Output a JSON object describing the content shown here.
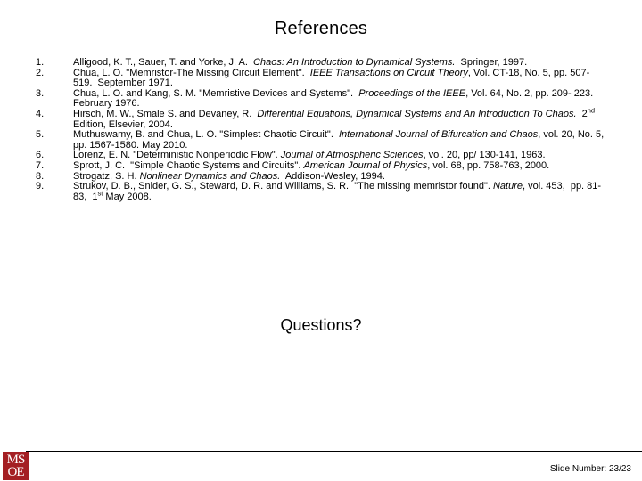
{
  "slide": {
    "title": "References",
    "questions": "Questions?",
    "slide_number_label": "Slide Number: 23/23"
  },
  "logo": {
    "name": "msoe-logo",
    "line1": "MS",
    "line2": "OE",
    "color": "#A41F23"
  },
  "references": [
    {
      "number": "1.",
      "text_html": "Alligood, K. T., Sauer, T. and Yorke, J. A.&nbsp; <i>Chaos: An Introduction to Dynamical Systems.</i>&nbsp; Springer, 1997.",
      "plain": "Alligood, K. T., Sauer, T. and Yorke, J. A. Chaos: An Introduction to Dynamical Systems. Springer, 1997."
    },
    {
      "number": "2.",
      "text_html": "Chua, L. O. \"Memristor-The Missing Circuit Element\".&nbsp; <i>IEEE Transactions on Circuit Theory</i>, Vol. CT-18, No. 5, pp. 507- 519.&nbsp; September 1971.",
      "plain": "Chua, L. O. \"Memristor-The Missing Circuit Element\". IEEE Transactions on Circuit Theory, Vol. CT-18, No. 5, pp. 507- 519. September 1971."
    },
    {
      "number": "3.",
      "text_html": "Chua, L. O. and Kang, S. M. \"Memristive Devices and Systems\".&nbsp; <i>Proceedings of the IEEE</i>, Vol. 64, No. 2, pp. 209- 223.&nbsp; February 1976.",
      "plain": "Chua, L. O. and Kang, S. M. \"Memristive Devices and Systems\". Proceedings of the IEEE, Vol. 64, No. 2, pp. 209- 223. February 1976."
    },
    {
      "number": "4.",
      "text_html": "Hirsch, M. W., Smale S. and Devaney, R.&nbsp; <i>Differential Equations, Dynamical Systems and An Introduction To Chaos.</i>&nbsp; 2<sup>nd</sup> Edition, Elsevier, 2004.",
      "plain": "Hirsch, M. W., Smale S. and Devaney, R. Differential Equations, Dynamical Systems and An Introduction To Chaos. 2nd Edition, Elsevier, 2004."
    },
    {
      "number": "5.",
      "text_html": "Muthuswamy, B. and Chua, L. O. \"Simplest Chaotic Circuit\".&nbsp; <i>International Journal of Bifurcation and Chaos</i>, vol. 20, No. 5, pp. 1567-1580. May 2010.",
      "plain": "Muthuswamy, B. and Chua, L. O. \"Simplest Chaotic Circuit\". International Journal of Bifurcation and Chaos, vol. 20, No. 5, pp. 1567-1580. May 2010."
    },
    {
      "number": "6.",
      "text_html": "Lorenz, E. N. \"Deterministic Nonperiodic Flow\". <i>Journal of Atmospheric Sciences</i>, vol. 20, pp/ 130-141, 1963.",
      "plain": "Lorenz, E. N. \"Deterministic Nonperiodic Flow\". Journal of Atmospheric Sciences, vol. 20, pp/ 130-141, 1963."
    },
    {
      "number": "7.",
      "text_html": "Sprott, J. C.&nbsp; \"Simple Chaotic Systems and Circuits\". <i>American Journal of Physics</i>, vol. 68, pp. 758-763, 2000.",
      "plain": "Sprott, J. C. \"Simple Chaotic Systems and Circuits\". American Journal of Physics, vol. 68, pp. 758-763, 2000."
    },
    {
      "number": "8.",
      "text_html": "Strogatz, S. H. <i>Nonlinear Dynamics and Chaos.</i>&nbsp; Addison-Wesley, 1994.",
      "plain": "Strogatz, S. H. Nonlinear Dynamics and Chaos. Addison-Wesley, 1994."
    },
    {
      "number": "9.",
      "text_html": "Strukov, D. B., Snider, G. S., Steward, D. R. and Williams, S. R.&nbsp; \"The missing memristor found\". <i>Nature</i>, vol. 453,&nbsp; pp. 81-83,&nbsp; 1<sup>st</sup> May 2008.",
      "plain": "Strukov, D. B., Snider, G. S., Steward, D. R. and Williams, S. R. \"The missing memristor found\". Nature, vol. 453, pp. 81-83, 1st May 2008."
    }
  ]
}
